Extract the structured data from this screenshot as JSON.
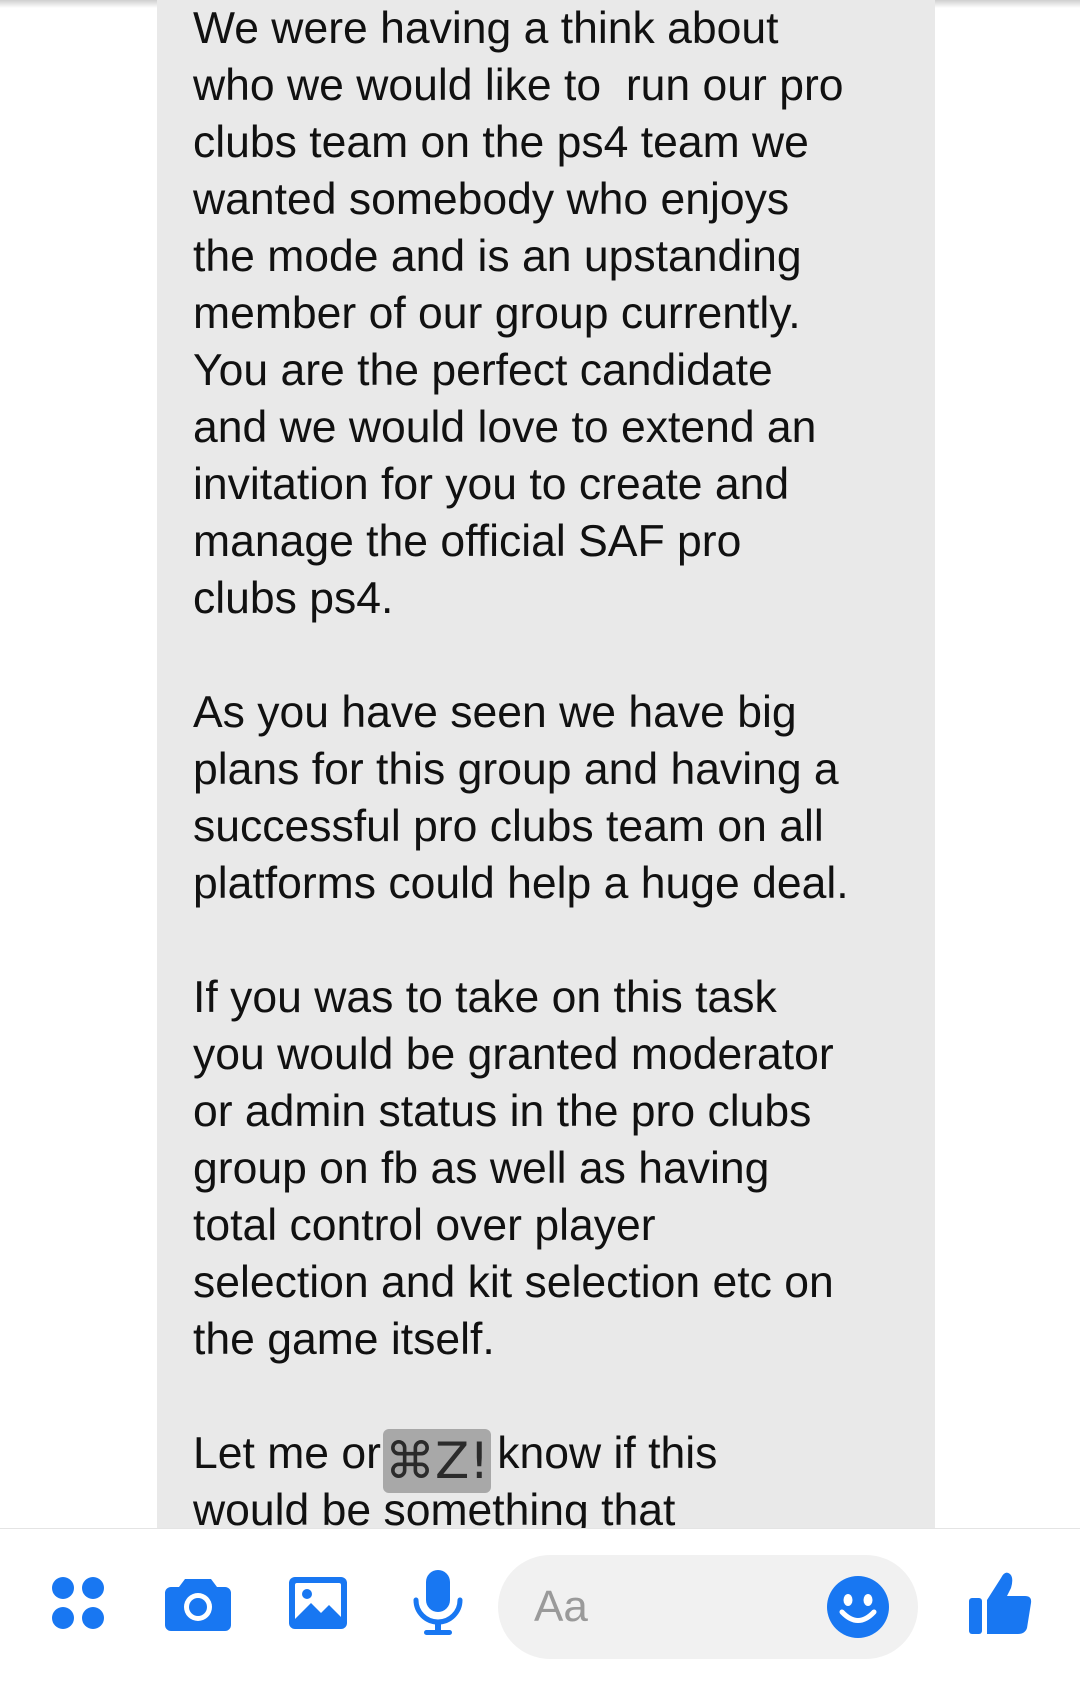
{
  "colors": {
    "bubble_bg": "#e9e9e9",
    "text": "#111111",
    "accent": "#1877f2",
    "placeholder": "#9a9a9a"
  },
  "message": {
    "paragraphs": [
      [
        "We were having a think about",
        "who we would like to  run our pro",
        "clubs team on the ps4 team we",
        "wanted somebody who enjoys",
        "the mode and is an upstanding",
        "member of our group currently.",
        "You are the perfect candidate",
        "and we would love to extend an",
        "invitation for you to create and",
        "manage the official SAF pro",
        "clubs ps4."
      ],
      [
        "As you have seen we have big",
        "plans for this group and having a",
        "successful pro clubs team on all",
        "platforms could help a huge deal."
      ],
      [
        "If you was to take on this task",
        "you would be granted moderator",
        "or admin status in the pro clubs",
        "group on fb as well as having",
        "total control over player",
        "selection and kit selection etc on",
        "the game itself."
      ]
    ],
    "last_line_prefix": "Let me or",
    "last_line_chip": "⌘Z!",
    "last_line_suffix": "know if this",
    "final_line": "would be something that"
  },
  "composer": {
    "tools": [
      {
        "name": "more-options-icon"
      },
      {
        "name": "camera-icon"
      },
      {
        "name": "gallery-icon"
      },
      {
        "name": "microphone-icon"
      }
    ],
    "placeholder": "Aa",
    "emoji_icon": "smiley-icon",
    "send_icon": "thumbs-up-icon"
  }
}
